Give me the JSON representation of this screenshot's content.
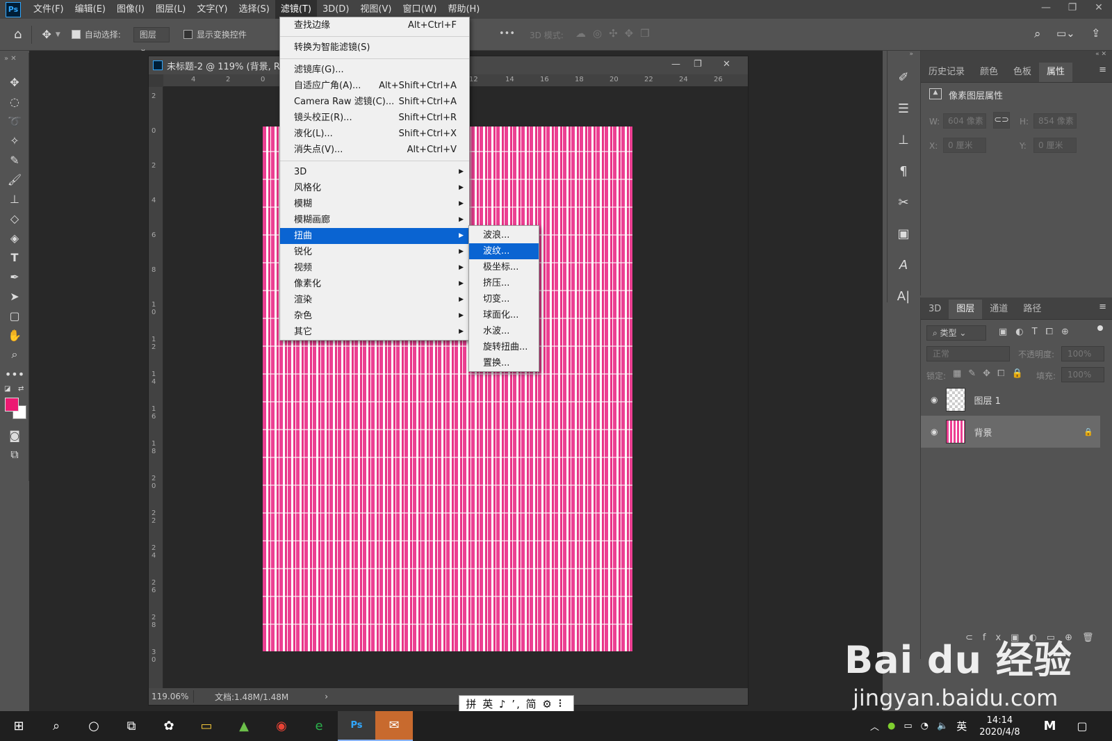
{
  "app": {
    "logo": "Ps",
    "menu": [
      "文件(F)",
      "编辑(E)",
      "图像(I)",
      "图层(L)",
      "文字(Y)",
      "选择(S)",
      "滤镜(T)",
      "3D(D)",
      "视图(V)",
      "窗口(W)",
      "帮助(H)"
    ],
    "active_menu_index": 6
  },
  "options": {
    "auto_select_label": "自动选择:",
    "auto_select_value": "图层",
    "show_transform_label": "显示变换控件",
    "more_label": "•••",
    "mode_3d_label": "3D 模式:"
  },
  "document": {
    "title": "未标题-2 @ 119% (背景, R",
    "zoom": "119.06%",
    "doc_info": "文档:1.48M/1.48M",
    "ruler_top": [
      "4",
      "2",
      "0",
      "12",
      "14",
      "16",
      "18",
      "20",
      "22",
      "24",
      "26"
    ],
    "ruler_left": [
      "2",
      "0",
      "2",
      "4",
      "6",
      "8",
      "10",
      "12",
      "14",
      "16",
      "18",
      "20",
      "22",
      "24",
      "26",
      "28",
      "30"
    ]
  },
  "filter_menu": {
    "items": [
      {
        "label": "查找边缘",
        "shortcut": "Alt+Ctrl+F"
      },
      {
        "sep": true
      },
      {
        "label": "转换为智能滤镜(S)",
        "shortcut": ""
      },
      {
        "sep": true
      },
      {
        "label": "滤镜库(G)...",
        "shortcut": ""
      },
      {
        "label": "自适应广角(A)...",
        "shortcut": "Alt+Shift+Ctrl+A"
      },
      {
        "label": "Camera Raw 滤镜(C)...",
        "shortcut": "Shift+Ctrl+A"
      },
      {
        "label": "镜头校正(R)...",
        "shortcut": "Shift+Ctrl+R"
      },
      {
        "label": "液化(L)...",
        "shortcut": "Shift+Ctrl+X"
      },
      {
        "label": "消失点(V)...",
        "shortcut": "Alt+Ctrl+V"
      },
      {
        "sep": true
      },
      {
        "label": "3D",
        "sub": true
      },
      {
        "label": "风格化",
        "sub": true
      },
      {
        "label": "模糊",
        "sub": true
      },
      {
        "label": "模糊画廊",
        "sub": true
      },
      {
        "label": "扭曲",
        "sub": true,
        "highlight": true
      },
      {
        "label": "锐化",
        "sub": true
      },
      {
        "label": "视频",
        "sub": true
      },
      {
        "label": "像素化",
        "sub": true
      },
      {
        "label": "渲染",
        "sub": true
      },
      {
        "label": "杂色",
        "sub": true
      },
      {
        "label": "其它",
        "sub": true
      }
    ]
  },
  "distort_submenu": {
    "items": [
      "波浪...",
      "波纹...",
      "极坐标...",
      "挤压...",
      "切变...",
      "球面化...",
      "水波...",
      "旋转扭曲...",
      "置换..."
    ],
    "highlight_index": 1
  },
  "properties_panel": {
    "tabs": [
      "历史记录",
      "颜色",
      "色板",
      "属性"
    ],
    "active_tab": 3,
    "header": "像素图层属性",
    "w_label": "W:",
    "w_value": "604 像素",
    "h_label": "H:",
    "h_value": "854 像素",
    "x_label": "X:",
    "x_value": "0 厘米",
    "y_label": "Y:",
    "y_value": "0 厘米"
  },
  "layers_panel": {
    "tabs": [
      "3D",
      "图层",
      "通道",
      "路径"
    ],
    "active_tab": 1,
    "filter_label": "类型",
    "blend_mode": "正常",
    "opacity_label": "不透明度:",
    "opacity_value": "100%",
    "lock_label": "锁定:",
    "fill_label": "填充:",
    "fill_value": "100%",
    "layers": [
      {
        "name": "图层 1",
        "selected": false,
        "locked": false
      },
      {
        "name": "背景",
        "selected": true,
        "locked": true
      }
    ]
  },
  "ime": {
    "text": "拼 英 ♪ ’, 简 ⚙ ⠇"
  },
  "taskbar": {
    "time": "14:14",
    "date": "2020/4/8",
    "lang": "英"
  },
  "watermark": {
    "brand": "Bai du 经验",
    "url": "jingyan.baidu.com"
  },
  "colors": {
    "foreground": "#ec1a72",
    "background": "#ffffff",
    "accent": "#0a64d2",
    "pattern_pink": "#ec3f92"
  }
}
